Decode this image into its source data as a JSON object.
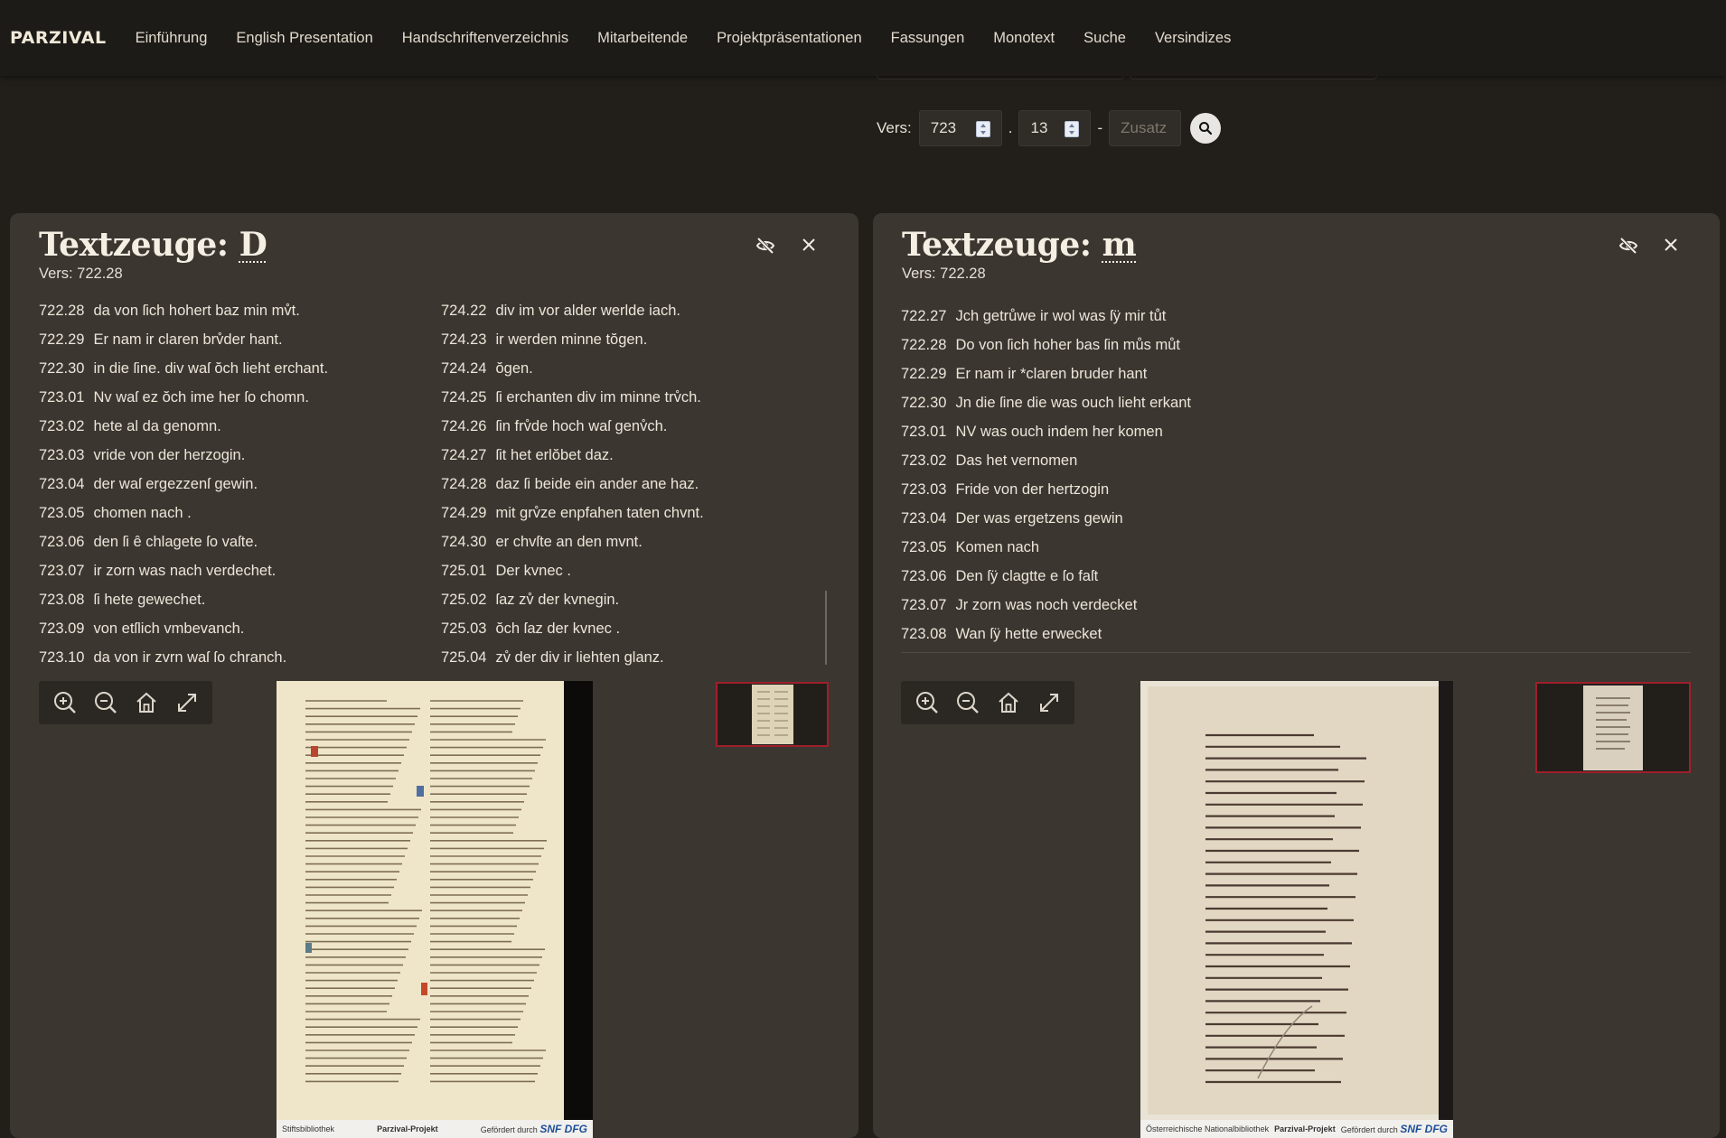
{
  "nav": {
    "brand": "PARZIVAL",
    "items": [
      "Einführung",
      "English Presentation",
      "Handschriftenverzeichnis",
      "Mitarbeitende",
      "Projektpräsentationen",
      "Fassungen",
      "Monotext",
      "Suche",
      "Versindizes"
    ]
  },
  "selector": {
    "label": "Vers:",
    "dreissiger": "723",
    "vers": "13",
    "dot": ".",
    "dash": "-",
    "zusatz_placeholder": "Zusatz"
  },
  "panels": [
    {
      "title_prefix": "Textzeuge: ",
      "siglum": "D",
      "vers": "Vers: 722.28",
      "columns": [
        [
          {
            "n": "722.28",
            "t": "da von ſich hohert baz min mv̊t."
          },
          {
            "n": "722.29",
            "t": "Er nam ir claren brv̊der hant."
          },
          {
            "n": "722.30",
            "t": "in die ſine. div waſ ŏch lieht erchant."
          },
          {
            "n": "723.01",
            "t": "Nv waſ ez ŏch ime her ſo chomn."
          },
          {
            "n": "723.02",
            "t": "hete al da genomn."
          },
          {
            "n": "723.03",
            "t": "vride von der herzogin."
          },
          {
            "n": "723.04",
            "t": "der waſ ergezzenſ gewin."
          },
          {
            "n": "723.05",
            "t": "chomen nach ."
          },
          {
            "n": "723.06",
            "t": "den ſi ê chlagete ſo vaſte."
          },
          {
            "n": "723.07",
            "t": "ir zorn was nach verdechet."
          },
          {
            "n": "723.08",
            "t": "ſi hete gewechet."
          },
          {
            "n": "723.09",
            "t": "von etſlich vmbevanch."
          },
          {
            "n": "723.10",
            "t": "da von ir zvrn waſ ſo chranch."
          }
        ],
        [
          {
            "n": "724.22",
            "t": "div im vor alder werlde iach."
          },
          {
            "n": "724.23",
            "t": "ir werden minne tŏgen."
          },
          {
            "n": "724.24",
            "t": "ŏgen."
          },
          {
            "n": "724.25",
            "t": "ſi erchanten div im minne trv̊ch."
          },
          {
            "n": "724.26",
            "t": "ſin frv̊de hoch waſ genv̊ch."
          },
          {
            "n": "724.27",
            "t": "ſit het erlŏbet daz."
          },
          {
            "n": "724.28",
            "t": "daz ſi beide ein ander ane haz."
          },
          {
            "n": "724.29",
            "t": "mit grv̊ze enpfahen taten chvnt."
          },
          {
            "n": "724.30",
            "t": "er chvſte an den mvnt."
          },
          {
            "n": "725.01",
            "t": "Der kvnec ."
          },
          {
            "n": "725.02",
            "t": "ſaz zv̊ der kvnegin."
          },
          {
            "n": "725.03",
            "t": "ŏch ſaz der kvnec ."
          },
          {
            "n": "725.04",
            "t": "zv̊ der div ir liehten glanz."
          }
        ]
      ],
      "footer": {
        "left": "Stiftsbibliothek",
        "mid": "Parzival-Projekt",
        "right_small": "Gefördert durch",
        "logos": "SNF DFG"
      }
    },
    {
      "title_prefix": "Textzeuge: ",
      "siglum": "m",
      "vers": "Vers: 722.28",
      "columns": [
        [
          {
            "n": "722.27",
            "t": "Jch getrůwe ir wol was ſÿ mir tůt"
          },
          {
            "n": "722.28",
            "t": "Do von ſich hoher bas ſin můs můt"
          },
          {
            "n": "722.29",
            "t": "Er nam ir *claren bruder hant"
          },
          {
            "n": "722.30",
            "t": "Jn die ſine die was ouch lieht erkant"
          },
          {
            "n": "723.01",
            "t": "NV was ouch indem her komen"
          },
          {
            "n": "723.02",
            "t": "Das het vernomen"
          },
          {
            "n": "723.03",
            "t": "Fride von der hertzogin"
          },
          {
            "n": "723.04",
            "t": "Der was ergetzens gewin"
          },
          {
            "n": "723.05",
            "t": "Komen nach"
          },
          {
            "n": "723.06",
            "t": "Den ſÿ clagtte e ſo faſt"
          },
          {
            "n": "723.07",
            "t": "Jr zorn was noch verdecket"
          },
          {
            "n": "723.08",
            "t": "Wan ſÿ hette erwecket"
          }
        ]
      ],
      "footer": {
        "left": "Österreichische Nationalbibliothek",
        "mid": "Parzival-Projekt",
        "right_small": "Gefördert durch",
        "logos": "SNF DFG"
      }
    }
  ]
}
